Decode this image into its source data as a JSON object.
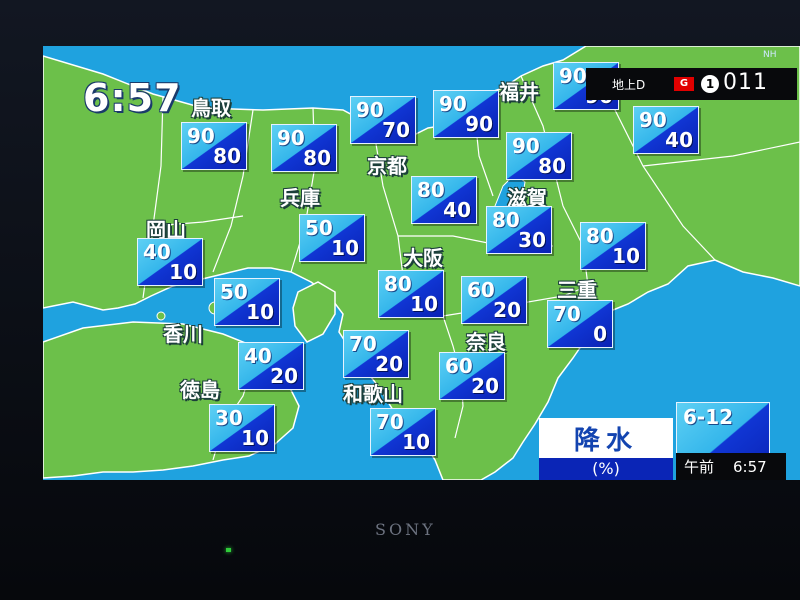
{
  "clock": "6:57",
  "channel": {
    "label": "地上D",
    "g_badge": "G",
    "circle": "1",
    "number": "011"
  },
  "corner_logo": "NH",
  "legend": {
    "title": "降水",
    "unit": "(%)"
  },
  "time_panel": {
    "range": "6-12",
    "ampm": "午前",
    "time": "6:57"
  },
  "brand": "SONY",
  "colors": {
    "sea": "#1fa2df",
    "land": "#6cc04a",
    "box_top": "#5ed0f4",
    "box_bottom": "#0a22b4"
  },
  "prefectures": [
    {
      "name": "鳥取"
    },
    {
      "name": "兵庫"
    },
    {
      "name": "京都"
    },
    {
      "name": "福井"
    },
    {
      "name": "滋賀"
    },
    {
      "name": "岡山"
    },
    {
      "name": "大阪"
    },
    {
      "name": "三重"
    },
    {
      "name": "香川"
    },
    {
      "name": "奈良"
    },
    {
      "name": "徳島"
    },
    {
      "name": "和歌山"
    }
  ],
  "forecasts": [
    {
      "id": "tottori",
      "v1": "90",
      "v2": "80"
    },
    {
      "id": "hyogo-north",
      "v1": "90",
      "v2": "80"
    },
    {
      "id": "kyoto-north",
      "v1": "90",
      "v2": "70"
    },
    {
      "id": "kyoto-mid",
      "v1": "90",
      "v2": "90"
    },
    {
      "id": "fukui",
      "v1": "90",
      "v2": "90"
    },
    {
      "id": "gifu",
      "v1": "90",
      "v2": "40"
    },
    {
      "id": "kyoto-south",
      "v1": "90",
      "v2": "80"
    },
    {
      "id": "hyogo-south",
      "v1": "80",
      "v2": "40"
    },
    {
      "id": "okayama",
      "v1": "40",
      "v2": "10"
    },
    {
      "id": "hyogo-west",
      "v1": "50",
      "v2": "10"
    },
    {
      "id": "shiga",
      "v1": "80",
      "v2": "30"
    },
    {
      "id": "mie-north",
      "v1": "80",
      "v2": "10"
    },
    {
      "id": "awaji",
      "v1": "50",
      "v2": "10"
    },
    {
      "id": "osaka",
      "v1": "80",
      "v2": "10"
    },
    {
      "id": "nara-north",
      "v1": "60",
      "v2": "20"
    },
    {
      "id": "mie-south",
      "v1": "70",
      "v2": "0"
    },
    {
      "id": "wakayama-north",
      "v1": "70",
      "v2": "20"
    },
    {
      "id": "kagawa",
      "v1": "40",
      "v2": "20"
    },
    {
      "id": "nara-south",
      "v1": "60",
      "v2": "20"
    },
    {
      "id": "tokushima",
      "v1": "30",
      "v2": "10"
    },
    {
      "id": "wakayama-south",
      "v1": "70",
      "v2": "10"
    }
  ]
}
